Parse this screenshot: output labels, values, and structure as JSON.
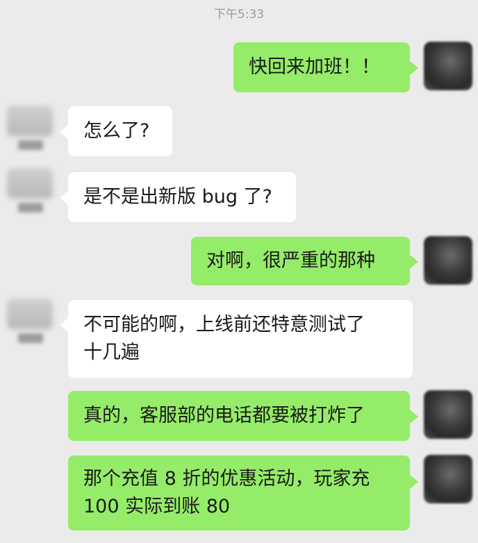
{
  "timestamp": "下午5:33",
  "messages": [
    {
      "from": "me",
      "text": "快回来加班！！"
    },
    {
      "from": "them",
      "text": "怎么了?"
    },
    {
      "from": "them",
      "text": "是不是出新版 bug 了?"
    },
    {
      "from": "me",
      "text": "对啊，很严重的那种"
    },
    {
      "from": "them",
      "line1": "不可能的啊，上线前还特意测试了",
      "line2": "十几遍"
    },
    {
      "from": "me",
      "text": "真的，客服部的电话都要被打炸了"
    },
    {
      "from": "me",
      "line1": "那个充值 8 折的优惠活动，玩家充",
      "line2": "100 实际到账 80"
    }
  ],
  "colors": {
    "background": "#ebebeb",
    "bubble_me": "#95ec69",
    "bubble_them": "#ffffff"
  }
}
